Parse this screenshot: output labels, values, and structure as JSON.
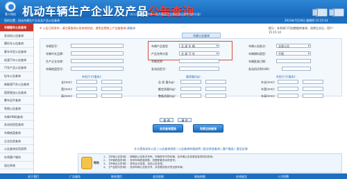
{
  "header": {
    "logo_text": "莱人科技",
    "title_part1": "机动车辆生产企业及产品",
    "title_part2": "公告查询",
    "subtitle": "（本公告数据以中华人民共和国工业和信息化部发布的为准）"
  },
  "navbar": {
    "location": "您的位置：机动车辆生产企业及产品公告查询",
    "date": "2013年7月18日 星期四 15:15:14"
  },
  "sidebar": {
    "items": [
      {
        "label": "车辆整车公告查询",
        "active": true
      },
      {
        "label": "发动机公告查询"
      },
      {
        "label": "摩托车公告查询"
      },
      {
        "label": "客车车型公告查询"
      },
      {
        "label": "低速汽车公告查询"
      },
      {
        "label": "汽车产品公告查询"
      },
      {
        "label": "挂车公告查询"
      },
      {
        "label": "新能源汽车公告查询"
      },
      {
        "label": "国家燃油公告查询"
      },
      {
        "label": "整车证件查询"
      },
      {
        "label": "免税公告查询"
      },
      {
        "label": "车辆VIN码查询"
      },
      {
        "label": "发动机机型查询"
      },
      {
        "label": "车辆底盘查询"
      },
      {
        "label": "企业信息查询"
      },
      {
        "label": "公告查询实用说明"
      },
      {
        "label": "在线客户服务"
      },
      {
        "label": "退出系统"
      }
    ]
  },
  "tip": {
    "part1": "※ 公告已经发布，请注意查询公告有效状态，避免出错致上产品被查询",
    "part2": "请查询",
    "user": "提示：本系统只可由数据库查询，选择企业后，用户：15:15:14"
  },
  "form": {
    "section_title": "车辆公告查询",
    "labels": {
      "model": "车辆型号：",
      "cn_brand": "车辆中文品牌：",
      "company": "生产企业名称：",
      "chassis": "车辆底盘型号：",
      "vehicle_type": "车辆产品类型",
      "product_category": "产品名称分类",
      "vehicle_name": "车辆名称：",
      "engine_model": "发动机型号：",
      "batch": "车辆公告批次：",
      "fuel_type": "车辆燃料类型：",
      "approval": "车辆批准日期：",
      "engine_power": "发动机功率(kW)："
    },
    "values": {
      "vehicle_type": "全 部 车 辆",
      "product_category": "全 部 汽 车",
      "batch": "全部公告",
      "fuel_type": "不限"
    },
    "groups": {
      "dim": "外形尺寸(毫米)：",
      "mass": "载质量(kg)：",
      "size": "外形尺寸(毫米)："
    },
    "range_labels": {
      "len": "长(mm)：",
      "wid": "宽(mm)：",
      "hei": "高(mm)：",
      "total": "总 质 量(kg)：",
      "rated": "额定质量(kg)：",
      "curb": "整备质量(kg)：",
      "len2": "车长(mm)：",
      "wid2": "车宽(mm)：",
      "hei2": "车高(mm)："
    },
    "buttons": {
      "query": "查 询",
      "reset": "清 空"
    }
  },
  "actions": {
    "login": "会员查询登陆",
    "register": "免费注册查询"
  },
  "links": "什么是机动车公告 | 公告查询须知 | 公告查询申请说明 | 批次状态查询 | 客户服务 | 意见反馈",
  "help": {
    "label": "帮助",
    "lines": [
      "1、【车辆公告查询】：精确到公告批次号码、车辆型号不同车辆，及车辆公告变更信息资料的查询；",
      "2、【车辆底盘查询】：查询车辆底盘参数，查看配套发动机型号；",
      "3、【车辆企业查询】：查询企业信息，包括公告信息；",
      "4、【产品批次查询】：查询车辆公告批次号，并查看该批次的全部车辆。"
    ]
  },
  "footer": {
    "items": [
      "关于我们",
      "广告服务",
      "联系我们",
      "会员权限",
      "网站地图",
      "在线留言",
      "人才招聘"
    ]
  }
}
